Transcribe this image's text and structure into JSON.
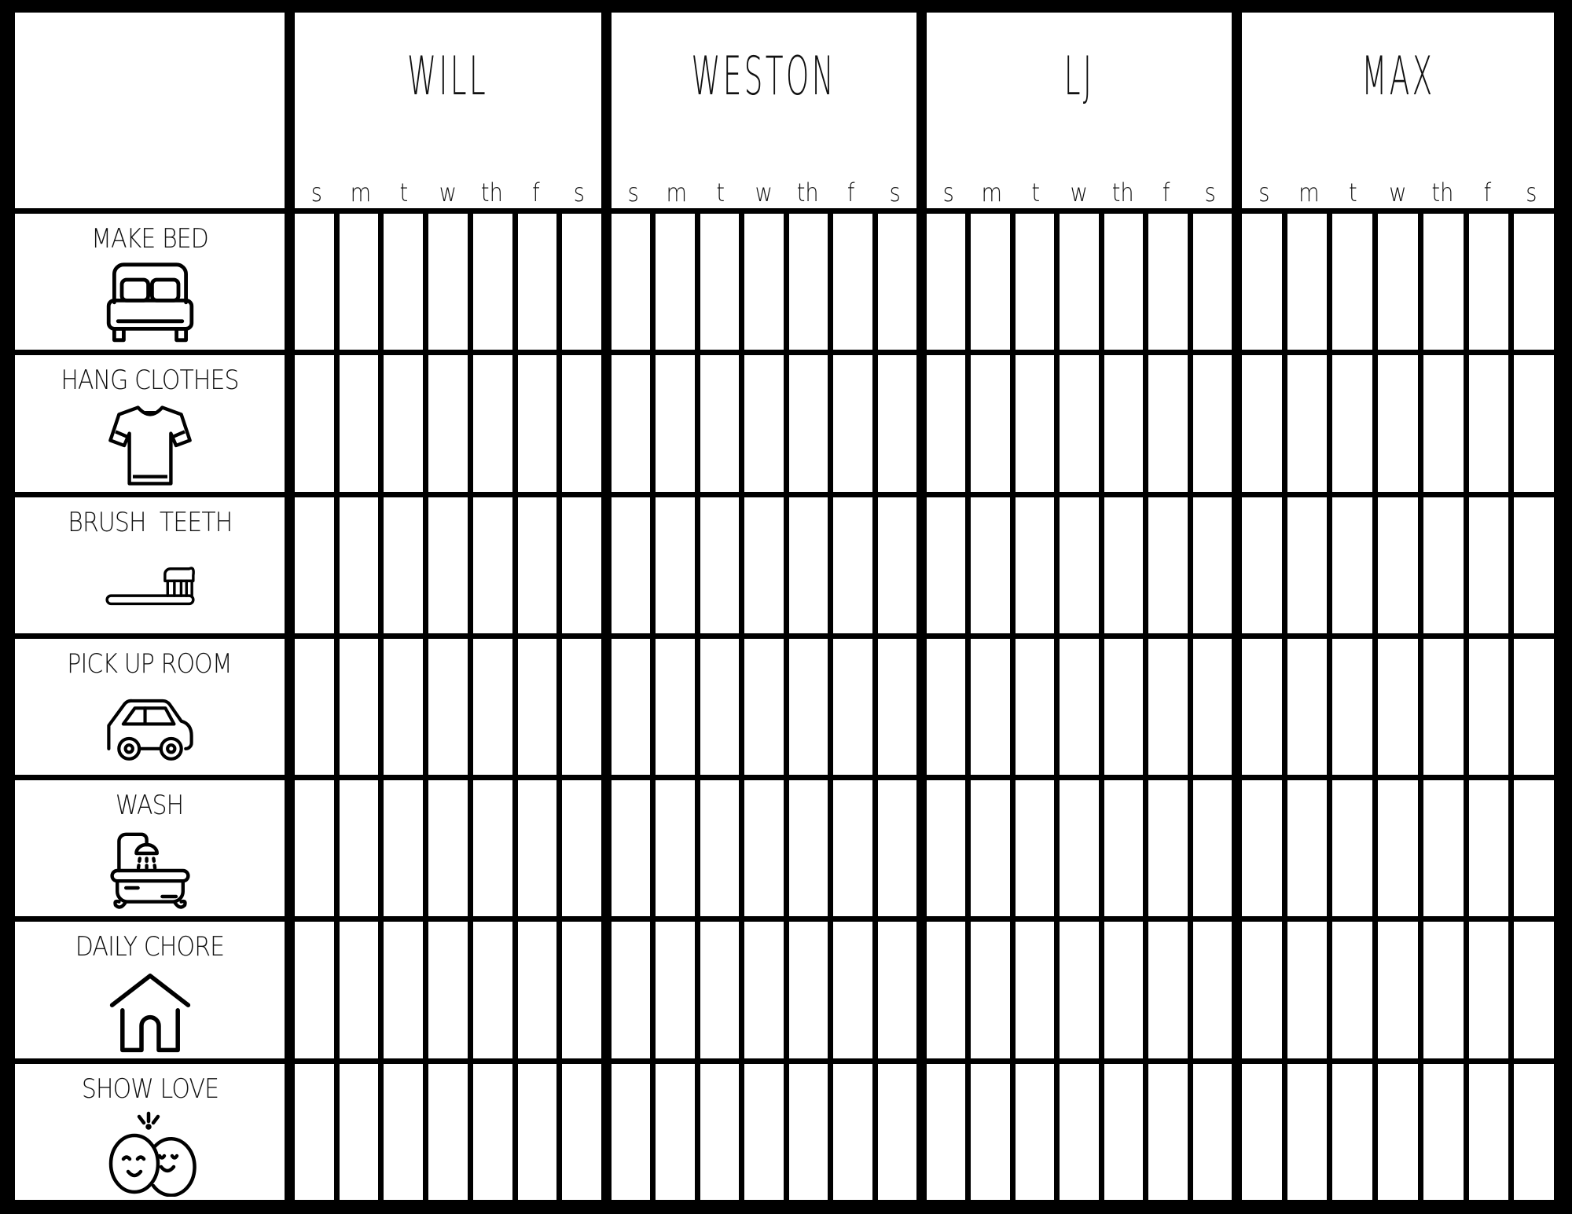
{
  "chart": {
    "kids": [
      {
        "name": "WILL"
      },
      {
        "name": "WESTON"
      },
      {
        "name": "LJ"
      },
      {
        "name": "MAX"
      }
    ],
    "days": [
      "s",
      "m",
      "t",
      "w",
      "th",
      "f",
      "s"
    ],
    "chores": [
      {
        "label": "MAKE BED",
        "icon": "bed-icon"
      },
      {
        "label": "HANG CLOTHES",
        "icon": "tshirt-icon"
      },
      {
        "label": "BRUSH  TEETH",
        "icon": "toothbrush-icon"
      },
      {
        "label": "PICK UP ROOM",
        "icon": "car-icon"
      },
      {
        "label": "WASH",
        "icon": "bathtub-icon"
      },
      {
        "label": "DAILY CHORE",
        "icon": "house-icon"
      },
      {
        "label": "SHOW LOVE",
        "icon": "hugging-faces-icon"
      }
    ],
    "colors": {
      "ink": "#000000",
      "paper": "#ffffff"
    }
  }
}
